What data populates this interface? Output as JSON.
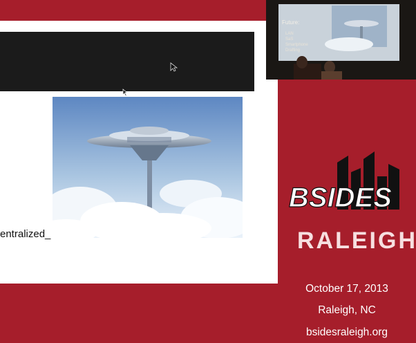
{
  "slide": {
    "visible_text": "entralized_",
    "image_name": "cloud-city-image"
  },
  "video": {
    "title": "Future:",
    "items": [
      "LAN",
      "SaS",
      "Smartphone",
      "Drafting"
    ]
  },
  "brand": {
    "logo_top": "BSIDES",
    "logo_bottom": "RALEIGH",
    "date": "October 17, 2013",
    "location": "Raleigh, NC",
    "url": "bsidesraleigh.org"
  },
  "colors": {
    "background_red": "#a61e2b",
    "logo_black": "#111111",
    "logo_white": "#ffffff"
  }
}
